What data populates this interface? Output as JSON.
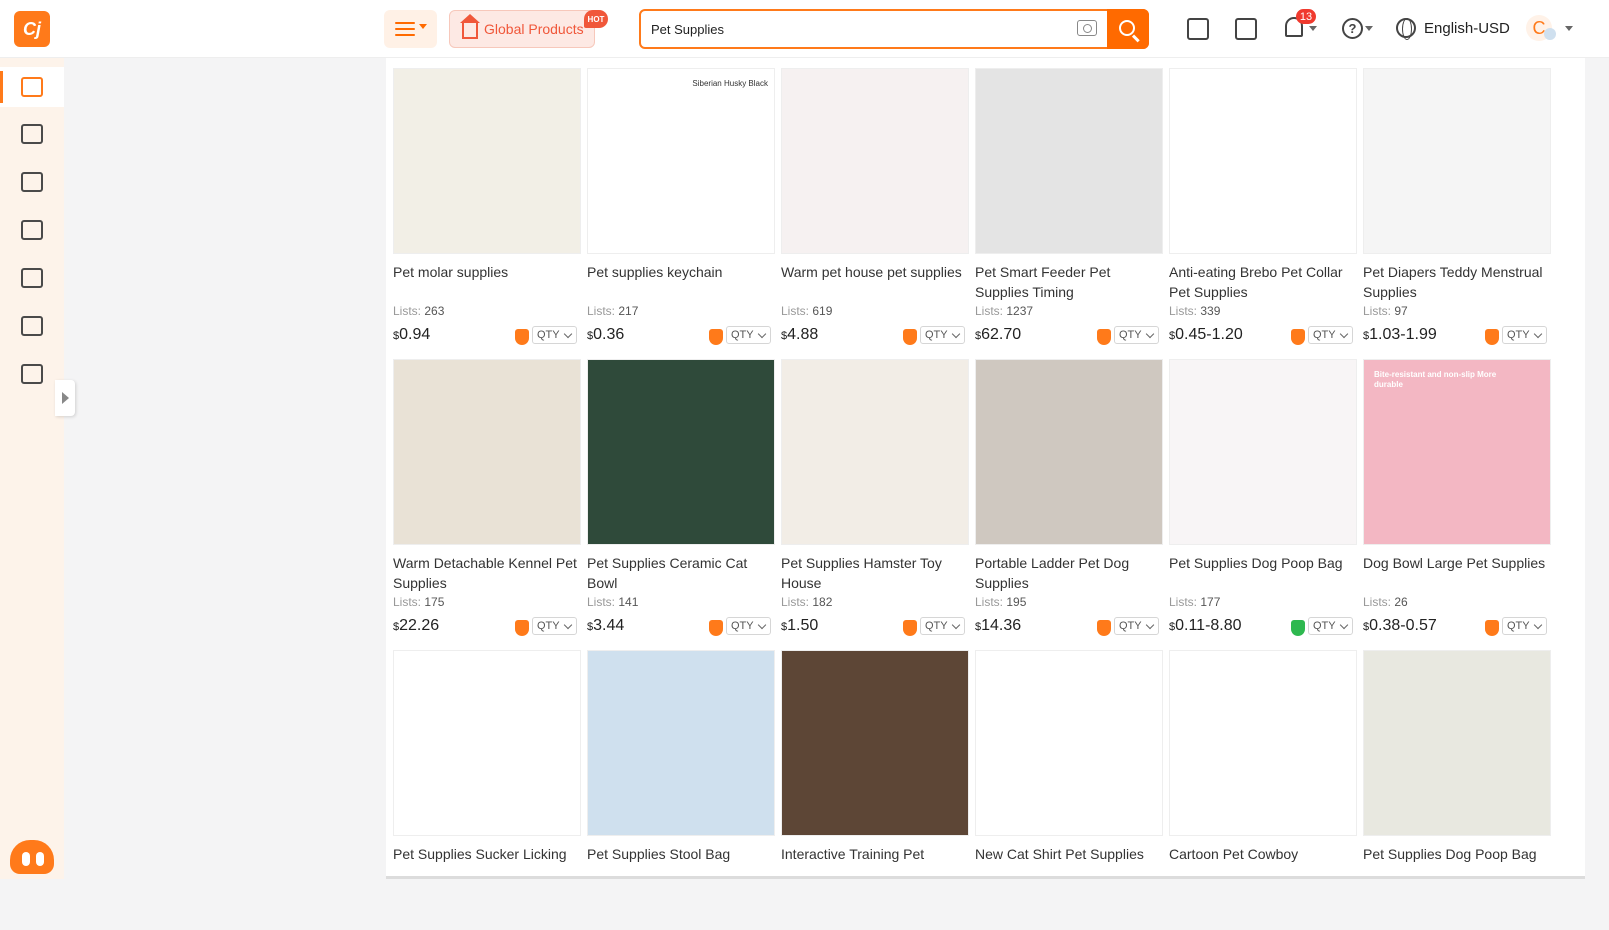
{
  "header": {
    "logo_text": "Cj",
    "global_products_label": "Global Products",
    "hot_label": "HOT",
    "search_value": "Pet Supplies",
    "notification_count": "13",
    "language": "English-USD",
    "avatar_letter": "C",
    "accent_color": "#ff6a00"
  },
  "sidebar": {
    "items": [
      "product-search",
      "cart",
      "orders",
      "lists",
      "bundles",
      "store",
      "dashboard"
    ]
  },
  "labels": {
    "lists_prefix": "Lists:",
    "qty": "QTY",
    "currency": "$"
  },
  "products": [
    {
      "title": "Pet molar supplies",
      "lists": "263",
      "price": "0.94",
      "img_color": "#f2efe6",
      "tag": ""
    },
    {
      "title": "Pet supplies keychain",
      "lists": "217",
      "price": "0.36",
      "img_color": "#ffffff",
      "tag": "Siberian Husky Black"
    },
    {
      "title": "Warm pet house pet supplies",
      "lists": "619",
      "price": "4.88",
      "img_color": "#f6f1f1",
      "tag": ""
    },
    {
      "title": "Pet Smart Feeder Pet Supplies Timing",
      "lists": "1237",
      "price": "62.70",
      "img_color": "#e4e4e4",
      "tag": ""
    },
    {
      "title": "Anti-eating Brebo Pet Collar Pet Supplies",
      "lists": "339",
      "price": "0.45-1.20",
      "img_color": "#ffffff",
      "tag": ""
    },
    {
      "title": "Pet Diapers Teddy Menstrual Supplies",
      "lists": "97",
      "price": "1.03-1.99",
      "img_color": "#f5f5f5",
      "tag": ""
    },
    {
      "title": "Warm Detachable Kennel Pet Supplies",
      "lists": "175",
      "price": "22.26",
      "img_color": "#e9e2d6",
      "tag": ""
    },
    {
      "title": "Pet Supplies Ceramic Cat Bowl",
      "lists": "141",
      "price": "3.44",
      "img_color": "#2f4a3a",
      "tag": ""
    },
    {
      "title": "Pet Supplies Hamster Toy House",
      "lists": "182",
      "price": "1.50",
      "img_color": "#f2ede6",
      "tag": ""
    },
    {
      "title": "Portable Ladder Pet Dog Supplies",
      "lists": "195",
      "price": "14.36",
      "img_color": "#cfc8c0",
      "tag": ""
    },
    {
      "title": "Pet Supplies Dog Poop Bag",
      "lists": "177",
      "price": "0.11-8.80",
      "img_color": "#f8f5f6",
      "tag": "",
      "green": true
    },
    {
      "title": "Dog Bowl Large Pet Supplies",
      "lists": "26",
      "price": "0.38-0.57",
      "img_color": "#f3b7c3",
      "tag": "Bite-resistant and non-slip More durable"
    },
    {
      "title": "Pet Supplies Sucker Licking",
      "lists": "",
      "price": "",
      "img_color": "#ffffff",
      "tag": ""
    },
    {
      "title": "Pet Supplies Stool Bag",
      "lists": "",
      "price": "",
      "img_color": "#cfe0ee",
      "tag": ""
    },
    {
      "title": "Interactive Training Pet",
      "lists": "",
      "price": "",
      "img_color": "#5d4636",
      "tag": ""
    },
    {
      "title": "New Cat Shirt Pet Supplies",
      "lists": "",
      "price": "",
      "img_color": "#ffffff",
      "tag": ""
    },
    {
      "title": "Cartoon Pet Cowboy",
      "lists": "",
      "price": "",
      "img_color": "#ffffff",
      "tag": ""
    },
    {
      "title": "Pet Supplies Dog Poop Bag",
      "lists": "",
      "price": "",
      "img_color": "#e8e8e0",
      "tag": ""
    }
  ]
}
